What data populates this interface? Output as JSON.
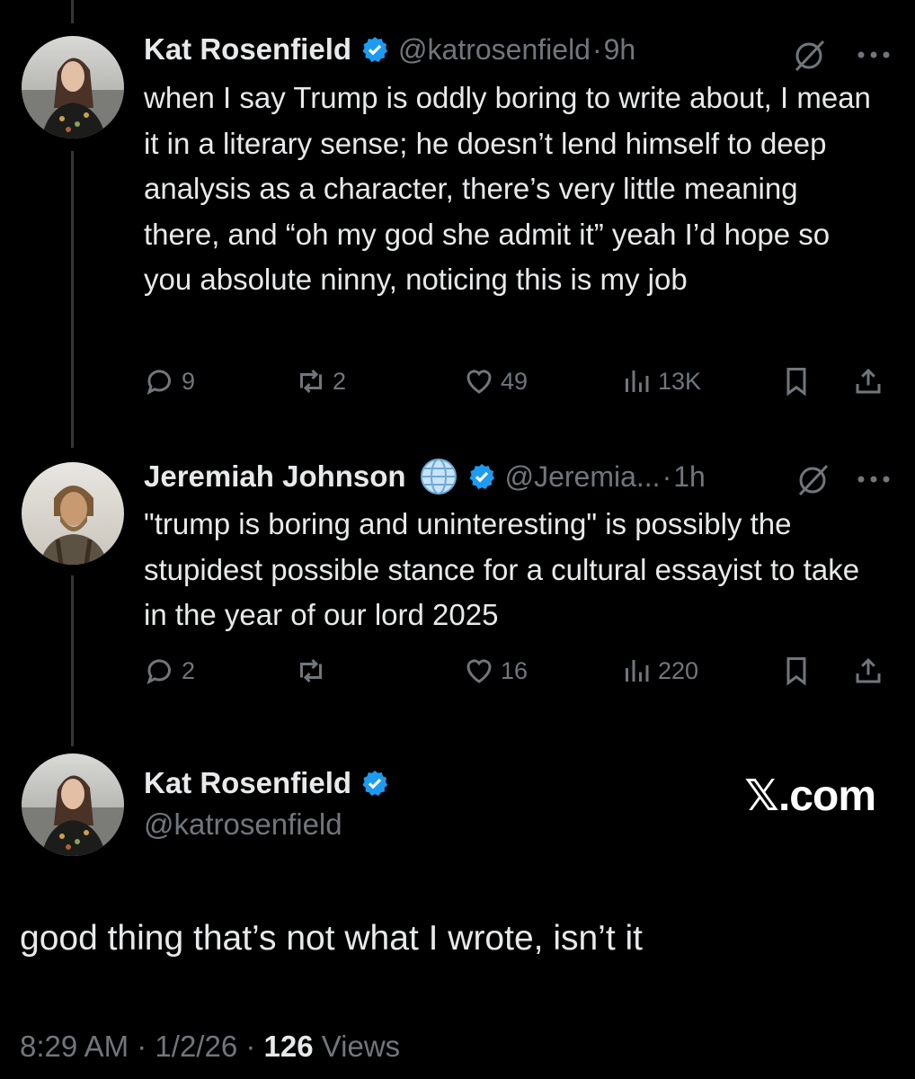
{
  "tweet1": {
    "name": "Kat Rosenfield",
    "handle": "@katrosenfield",
    "time": "9h",
    "text": "when I say Trump is oddly boring to write about, I mean it in a literary sense; he doesn’t lend himself to deep analysis as a character, there’s very little meaning there, and “oh my god she admit it” yeah I’d hope so you absolute ninny, noticing this is my job",
    "replies": "9",
    "reposts": "2",
    "likes": "49",
    "views": "13K"
  },
  "tweet2": {
    "name": "Jeremiah Johnson",
    "handle": "@Jeremia...",
    "time": "1h",
    "text": "\"trump is boring and uninteresting\" is possibly the stupidest possible stance for a cultural essayist to take in the year of our lord 2025",
    "replies": "2",
    "reposts": "",
    "likes": "16",
    "views": "220"
  },
  "main": {
    "name": "Kat Rosenfield",
    "handle": "@katrosenfield",
    "text": "good thing that’s not what I wrote, isn’t it",
    "time": "8:29 AM",
    "date": "1/2/26",
    "views_count": "126",
    "views_label": "Views"
  },
  "watermark": "𝕏.com",
  "colors": {
    "background": "#000000",
    "muted": "#71767b",
    "verified": "#1d9bf0",
    "text": "#e7e9ea"
  },
  "icons": [
    "verified-badge-icon",
    "globe-icon",
    "grok-icon",
    "more-icon",
    "reply-icon",
    "repost-icon",
    "like-icon",
    "views-icon",
    "bookmark-icon",
    "share-icon"
  ]
}
